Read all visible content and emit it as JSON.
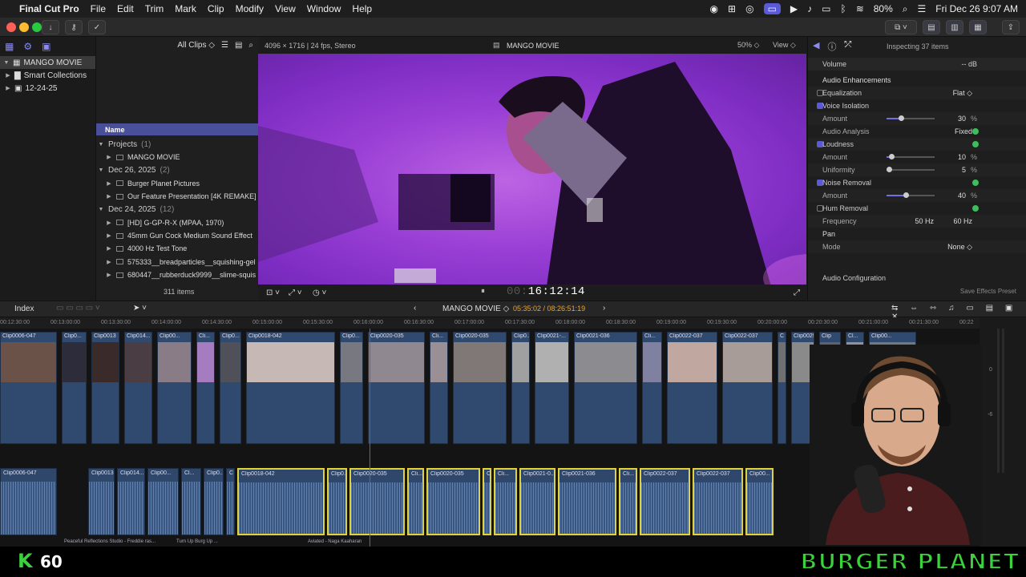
{
  "menubar": {
    "app": "Final Cut Pro",
    "items": [
      "File",
      "Edit",
      "Trim",
      "Mark",
      "Clip",
      "Modify",
      "View",
      "Window",
      "Help"
    ],
    "battery": "80%",
    "clock": "Fri Dec 26  9:07 AM"
  },
  "library": {
    "items": [
      {
        "label": "MANGO MOVIE"
      },
      {
        "label": "Smart Collections"
      },
      {
        "label": "12-24-25"
      }
    ]
  },
  "browser": {
    "filter": "All Clips",
    "column_name": "Name",
    "footer_count": "311 items",
    "rows": [
      {
        "label": "Projects",
        "count": "(1)",
        "kind": "group"
      },
      {
        "label": "MANGO MOVIE",
        "kind": "item"
      },
      {
        "label": "Dec 26, 2025",
        "count": "(2)",
        "kind": "group"
      },
      {
        "label": "Burger Planet Pictures",
        "kind": "item"
      },
      {
        "label": "Our Feature Presentation [4K REMAKE]",
        "kind": "item"
      },
      {
        "label": "Dec 24, 2025",
        "count": "(12)",
        "kind": "group"
      },
      {
        "label": "[HD] G-GP-R-X (MPAA, 1970)",
        "kind": "item"
      },
      {
        "label": "45mm Gun Cock Medium Sound Effect",
        "kind": "item"
      },
      {
        "label": "4000 Hz Test Tone",
        "kind": "item"
      },
      {
        "label": "575333__breadparticles__squishing-gel",
        "kind": "item"
      },
      {
        "label": "680447__rubberduck9999__slime-squis",
        "kind": "item"
      }
    ]
  },
  "viewer": {
    "format": "4096 × 1716 | 24 fps, Stereo",
    "project": "MANGO MOVIE",
    "zoom": "50%",
    "view_label": "View",
    "timecode": "16:12:14",
    "timecode_prefix": "00:"
  },
  "inspector": {
    "title": "Inspecting 37 items",
    "volume_label": "Volume",
    "volume_value": "-- dB",
    "section": "Audio Enhancements",
    "rows": [
      {
        "label": "Equalization",
        "value": "Flat ◇",
        "check": "off"
      },
      {
        "label": "Voice Isolation",
        "check": "on"
      },
      {
        "label": "Amount",
        "value": "30",
        "unit": "%",
        "slider": 0.3
      },
      {
        "label": "Audio Analysis",
        "value": "Fixed",
        "dot": true
      },
      {
        "label": "Loudness",
        "check": "on",
        "dot": true
      },
      {
        "label": "Amount",
        "value": "10",
        "unit": "%",
        "slider": 0.1
      },
      {
        "label": "Uniformity",
        "value": "5",
        "unit": "%",
        "slider": 0.05
      },
      {
        "label": "Noise Removal",
        "check": "on",
        "dot": true
      },
      {
        "label": "Amount",
        "value": "40",
        "unit": "%",
        "slider": 0.4
      },
      {
        "label": "Hum Removal",
        "check": "off",
        "dot": true
      },
      {
        "label": "Frequency",
        "value": "50 Hz",
        "value2": "60 Hz"
      },
      {
        "label": "Pan",
        "kind": "section"
      },
      {
        "label": "Mode",
        "value": "None ◇"
      }
    ],
    "audio_config": "Audio Configuration",
    "save_preset": "Save Effects Preset"
  },
  "timeline": {
    "index_label": "Index",
    "project": "MANGO MOVIE",
    "timecode": "05:35:02 / 08:26:51:19",
    "ruler": [
      "00:12:30:00",
      "00:13:00:00",
      "00:13:30:00",
      "00:14:00:00",
      "00:14:30:00",
      "00:15:00:00",
      "00:15:30:00",
      "00:16:00:00",
      "00:16:30:00",
      "00:17:00:00",
      "00:17:30:00",
      "00:18:00:00",
      "00:18:30:00",
      "00:19:00:00",
      "00:19:30:00",
      "00:20:00:00",
      "00:20:30:00",
      "00:21:00:00",
      "00:21:30:00",
      "00:22"
    ],
    "video_clips": [
      "Clip0006-047",
      "Clip0...",
      "Clip0013",
      "Clip014...",
      "Clip00...",
      "Cli...",
      "Clip0...",
      "Clip0018-042",
      "Clip0...",
      "Clip0020-035",
      "Cli...",
      "Clip0020-035",
      "Clip0...",
      "Clip0021-...",
      "Clip0021-036",
      "Cli...",
      "Clip0022-037",
      "Clip0022-037",
      "C",
      "Clip0029",
      "Clip",
      "Cl...",
      "Clip00..."
    ],
    "audio_clips": [
      "Clip0006-047",
      "Clip0013",
      "Clip014...",
      "Clip00...",
      "Cl...",
      "Clip0...",
      "C",
      "Clip0018-042",
      "Clip0...",
      "Clip0020-035",
      "Cli...",
      "Clip0020-035",
      "C",
      "Cli...",
      "Clip0021-0...",
      "Clip0021-036",
      "Cli...",
      "Clip0022-037",
      "Clip0022-037",
      "Clip00..."
    ],
    "bottom_labels": [
      "Peaceful Reflections Studio - Freddie ras...",
      "Turn Up Burg Up ...",
      "Aviated - Naga Kaaharan"
    ],
    "meters": [
      "0",
      "-6"
    ]
  },
  "overlay": {
    "k_count": "60",
    "brand": "BURGER PLANET"
  },
  "colors": {
    "accent": "#5a5ad8",
    "selection": "#e2d23a",
    "green": "#3cd23c",
    "viewer_purple": "#9b3fd6"
  }
}
